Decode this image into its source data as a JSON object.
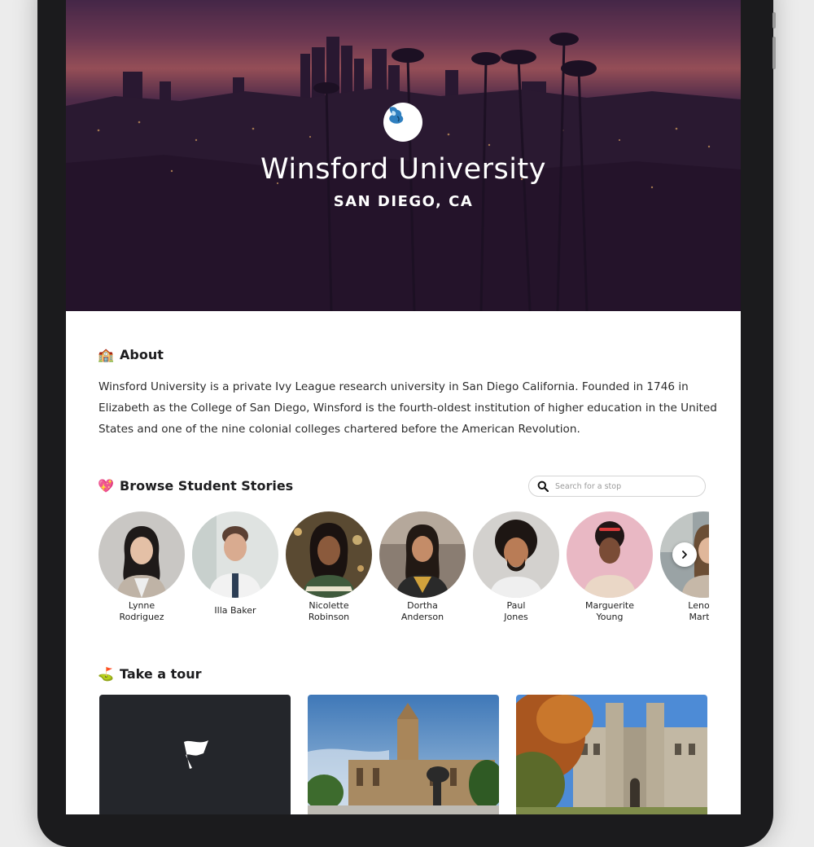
{
  "hero": {
    "title": "Winsford University",
    "subtitle": "SAN DIEGO, CA",
    "logo_icon": "griffin-logo-icon"
  },
  "about": {
    "emoji": "🏫",
    "heading": "About",
    "text": "Winsford University is a private Ivy League research university in San Diego California. Founded in 1746 in Elizabeth as the College of San Diego, Winsford is the fourth-oldest institution of higher education in the United States and one of the nine colonial colleges chartered before the American Revolution."
  },
  "stories": {
    "emoji": "💖",
    "heading": "Browse Student Stories",
    "search_placeholder": "Search for a stop",
    "next_icon": "chevron-right-icon",
    "people": [
      {
        "line1": "Lynne",
        "line2": "Rodriguez"
      },
      {
        "line1": "Illa Baker",
        "line2": ""
      },
      {
        "line1": "Nicolette",
        "line2": "Robinson"
      },
      {
        "line1": "Dortha",
        "line2": "Anderson"
      },
      {
        "line1": "Paul",
        "line2": "Jones"
      },
      {
        "line1": "Marguerite",
        "line2": "Young"
      },
      {
        "line1": "Lenore",
        "line2": "Martin"
      }
    ]
  },
  "tour": {
    "emoji": "⛳",
    "heading": "Take a tour",
    "cards": [
      {
        "icon": "flag-icon"
      },
      {
        "icon": "campus-photo"
      },
      {
        "icon": "campus-photo"
      }
    ]
  },
  "colors": {
    "hero_purple": "#2a1630",
    "dark_card": "#24262b",
    "text": "#1d1d1f"
  }
}
